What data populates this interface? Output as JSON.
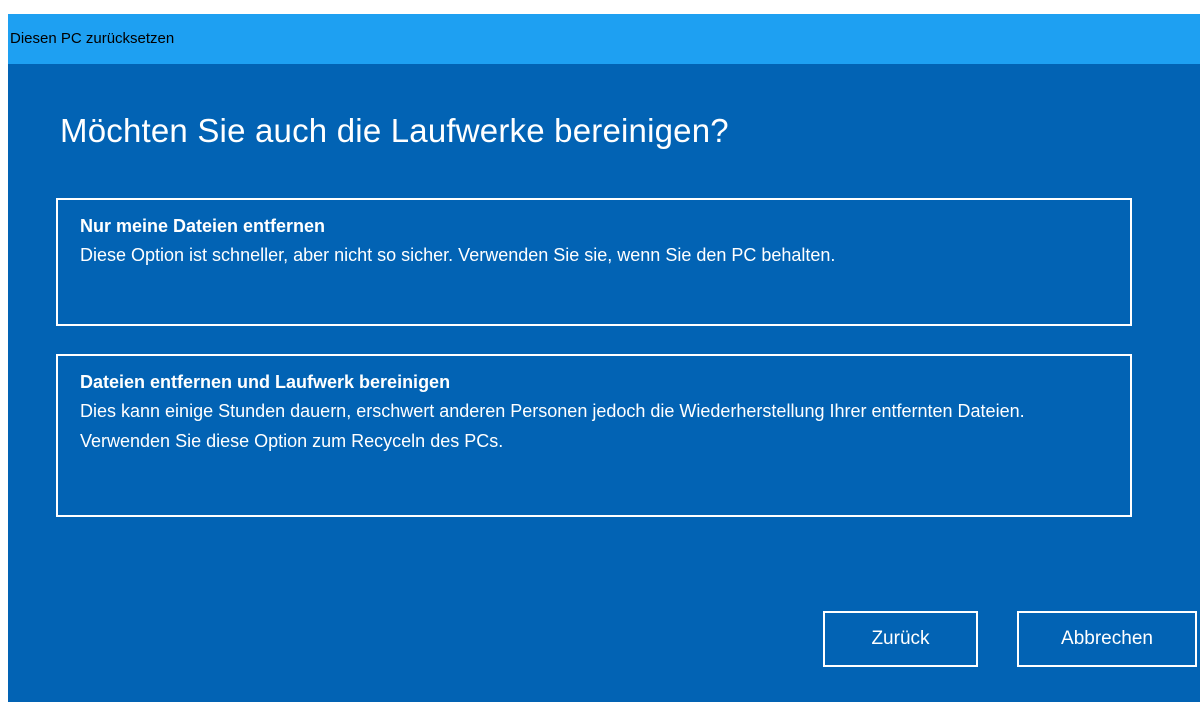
{
  "window": {
    "title": "Diesen PC zurücksetzen"
  },
  "main": {
    "heading": "Möchten Sie auch die Laufwerke bereinigen?",
    "options": [
      {
        "title": "Nur meine Dateien entfernen",
        "description": "Diese Option ist schneller, aber nicht so sicher. Verwenden Sie sie, wenn Sie den PC behalten."
      },
      {
        "title": "Dateien entfernen und Laufwerk bereinigen",
        "description": "Dies kann einige Stunden dauern, erschwert anderen Personen jedoch die Wiederherstellung Ihrer entfernten Dateien. Verwenden Sie diese Option zum Recyceln des PCs."
      }
    ]
  },
  "buttons": {
    "back_label": "Zurück",
    "cancel_label": "Abbrechen"
  },
  "colors": {
    "background": "#0263b4",
    "titlebar": "#1ea0f2",
    "text": "#ffffff"
  }
}
